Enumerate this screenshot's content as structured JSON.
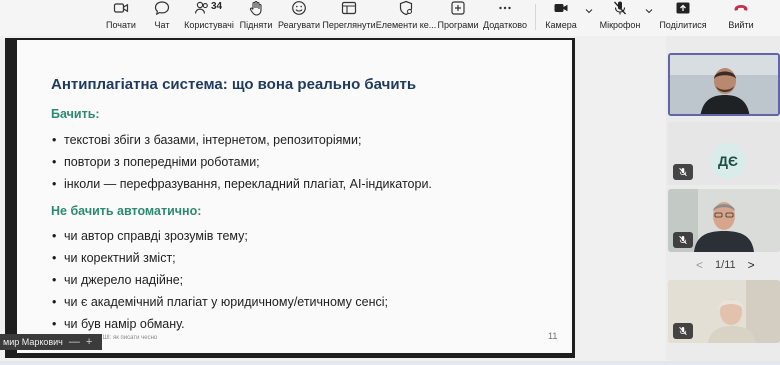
{
  "toolbar": {
    "items": [
      {
        "label": "Почати",
        "icon": "video-camera-outline-icon"
      },
      {
        "label": "Чат",
        "icon": "chat-bubble-icon"
      },
      {
        "label": "Користувачі",
        "icon": "people-icon",
        "count": "34"
      },
      {
        "label": "Підняти",
        "icon": "raise-hand-icon"
      },
      {
        "label": "Реагувати",
        "icon": "smiley-icon"
      },
      {
        "label": "Переглянути",
        "icon": "view-layout-icon"
      },
      {
        "label": "Елементи ке...",
        "icon": "shield-settings-icon"
      },
      {
        "label": "Програми",
        "icon": "apps-plus-icon"
      },
      {
        "label": "Додатково",
        "icon": "more-icon"
      },
      {
        "label": "Камера",
        "icon": "camera-icon"
      },
      {
        "label": "Мікрофон",
        "icon": "mic-off-icon"
      },
      {
        "label": "Поділитися",
        "icon": "share-icon"
      },
      {
        "label": "Вийти",
        "icon": "hang-up-icon"
      }
    ],
    "hangup_color": "#c4314b"
  },
  "slide": {
    "title": "Антиплагіатна система: що вона реально бачить",
    "section1": "Бачить:",
    "sees": [
      "текстові збіги з базами, інтернетом, репозиторіями;",
      "повтори з попередніми роботами;",
      "інколи — перефразування, перекладний плагіат, AI-індикатори."
    ],
    "section2": "Не бачить автоматично:",
    "not_sees": [
      "чи автор справді зрозумів тему;",
      "чи коректний зміст;",
      "чи джерело надійне;",
      "чи є академічний плагіат у юридичному/етичному сенсі;",
      "чи був намір обману."
    ],
    "footer": "Антиплагіатні системи та ШІ: як писати чесно",
    "page": "11",
    "title_color": "#1f3a5c",
    "section_color": "#2e8a6e"
  },
  "presenter_tag": {
    "name": "мир Маркович",
    "minimize": "—",
    "expand": "+"
  },
  "participants": {
    "initials": "ДЄ",
    "pager": "1/11",
    "prev": "<",
    "next": ">"
  }
}
